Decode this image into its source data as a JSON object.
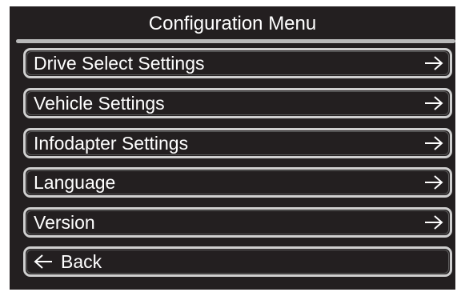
{
  "screen": {
    "title": "Configuration Menu"
  },
  "menu": {
    "items": [
      {
        "label": "Drive Select Settings",
        "icon": "arrow-right-icon"
      },
      {
        "label": "Vehicle Settings",
        "icon": "arrow-right-icon"
      },
      {
        "label": "Infodapter Settings",
        "icon": "arrow-right-icon"
      },
      {
        "label": "Language",
        "icon": "arrow-right-icon"
      },
      {
        "label": "Version",
        "icon": "arrow-right-icon"
      }
    ],
    "back": {
      "label": "Back",
      "icon": "arrow-left-icon"
    }
  },
  "colors": {
    "background": "#231f20",
    "border": "#cfcfcf",
    "text": "#ffffff",
    "rule": "#b9b9b9"
  }
}
